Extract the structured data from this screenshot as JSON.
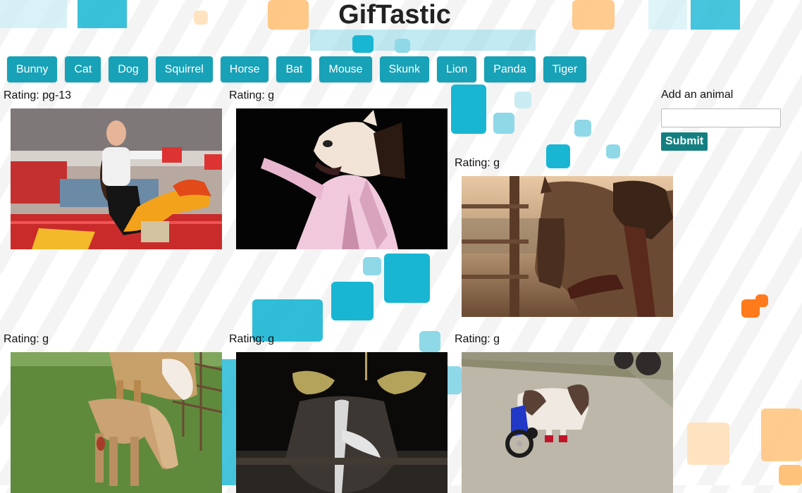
{
  "page": {
    "title": "GifTastic"
  },
  "animal_buttons": [
    "Bunny",
    "Cat",
    "Dog",
    "Squirrel",
    "Horse",
    "Bat",
    "Mouse",
    "Skunk",
    "Lion",
    "Panda",
    "Tiger"
  ],
  "gifs": [
    {
      "rating": "Rating: pg-13"
    },
    {
      "rating": "Rating: g"
    },
    {
      "rating": "Rating: g"
    },
    {
      "rating": "Rating: g"
    },
    {
      "rating": "Rating: g"
    },
    {
      "rating": "Rating: g"
    }
  ],
  "form": {
    "label": "Add an animal",
    "input_value": "",
    "submit_label": "Submit"
  },
  "colors": {
    "button": "#17a2b8",
    "submit": "#137f81",
    "title": "#222222"
  }
}
